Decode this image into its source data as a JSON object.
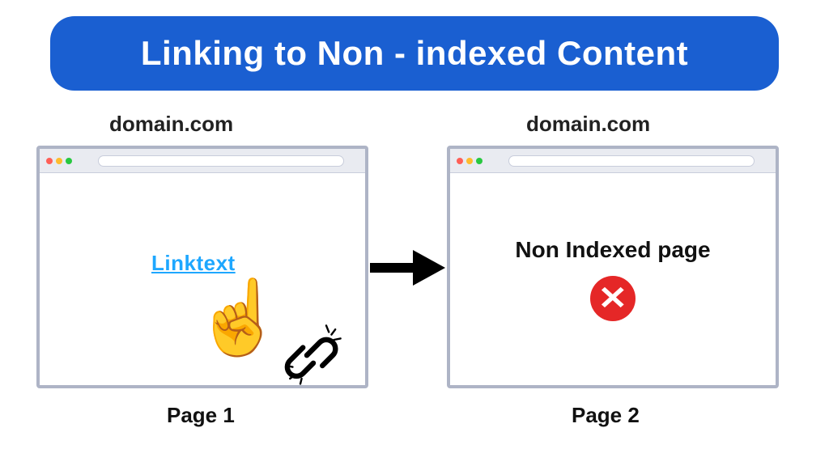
{
  "title": "Linking to Non - indexed Content",
  "left": {
    "domain": "domain.com",
    "link_text": "Linktext",
    "page_label": "Page 1"
  },
  "right": {
    "domain": "domain.com",
    "body_text": "Non Indexed page",
    "page_label": "Page 2"
  }
}
